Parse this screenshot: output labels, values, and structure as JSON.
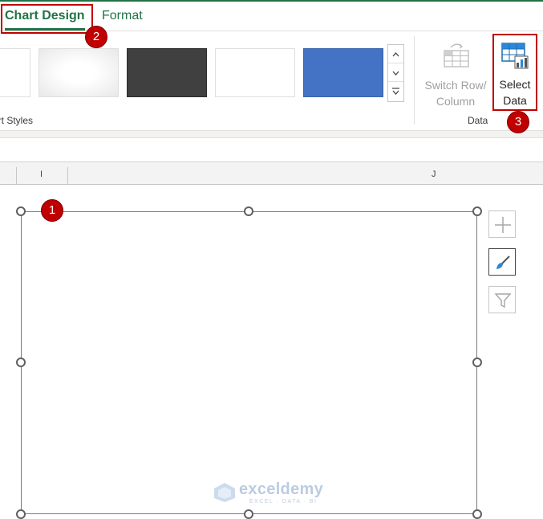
{
  "tabs": [
    {
      "label": "Chart Design",
      "active": true
    },
    {
      "label": "Format",
      "active": false
    }
  ],
  "ribbon": {
    "chart_styles_label": "art Styles",
    "chart_styles_label_full": "Chart Styles",
    "gallery_swatches": [
      "#ffffff",
      "#f0f0f0",
      "#404040",
      "#ffffff",
      "#4472c4"
    ],
    "scroll_up": "˄",
    "scroll_down": "˅",
    "scroll_more": "⩡",
    "switch_row_column": {
      "line1": "Switch Row/",
      "line2": "Column",
      "enabled": false
    },
    "select_data": {
      "line1": "Select",
      "line2": "Data"
    },
    "data_group_label": "Data"
  },
  "columns": [
    "I",
    "J"
  ],
  "side_buttons": [
    {
      "icon": "plus-icon",
      "name": "chart-elements"
    },
    {
      "icon": "brush-icon",
      "name": "chart-styles"
    },
    {
      "icon": "filter-icon",
      "name": "chart-filters"
    }
  ],
  "badges": [
    "1",
    "2",
    "3"
  ],
  "watermark": {
    "name": "exceldemy",
    "tagline": "EXCEL · DATA · BI"
  },
  "colors": {
    "accent": "#217346",
    "highlight": "#c00000",
    "style_blue": "#4472c4",
    "style_dark": "#404040"
  }
}
